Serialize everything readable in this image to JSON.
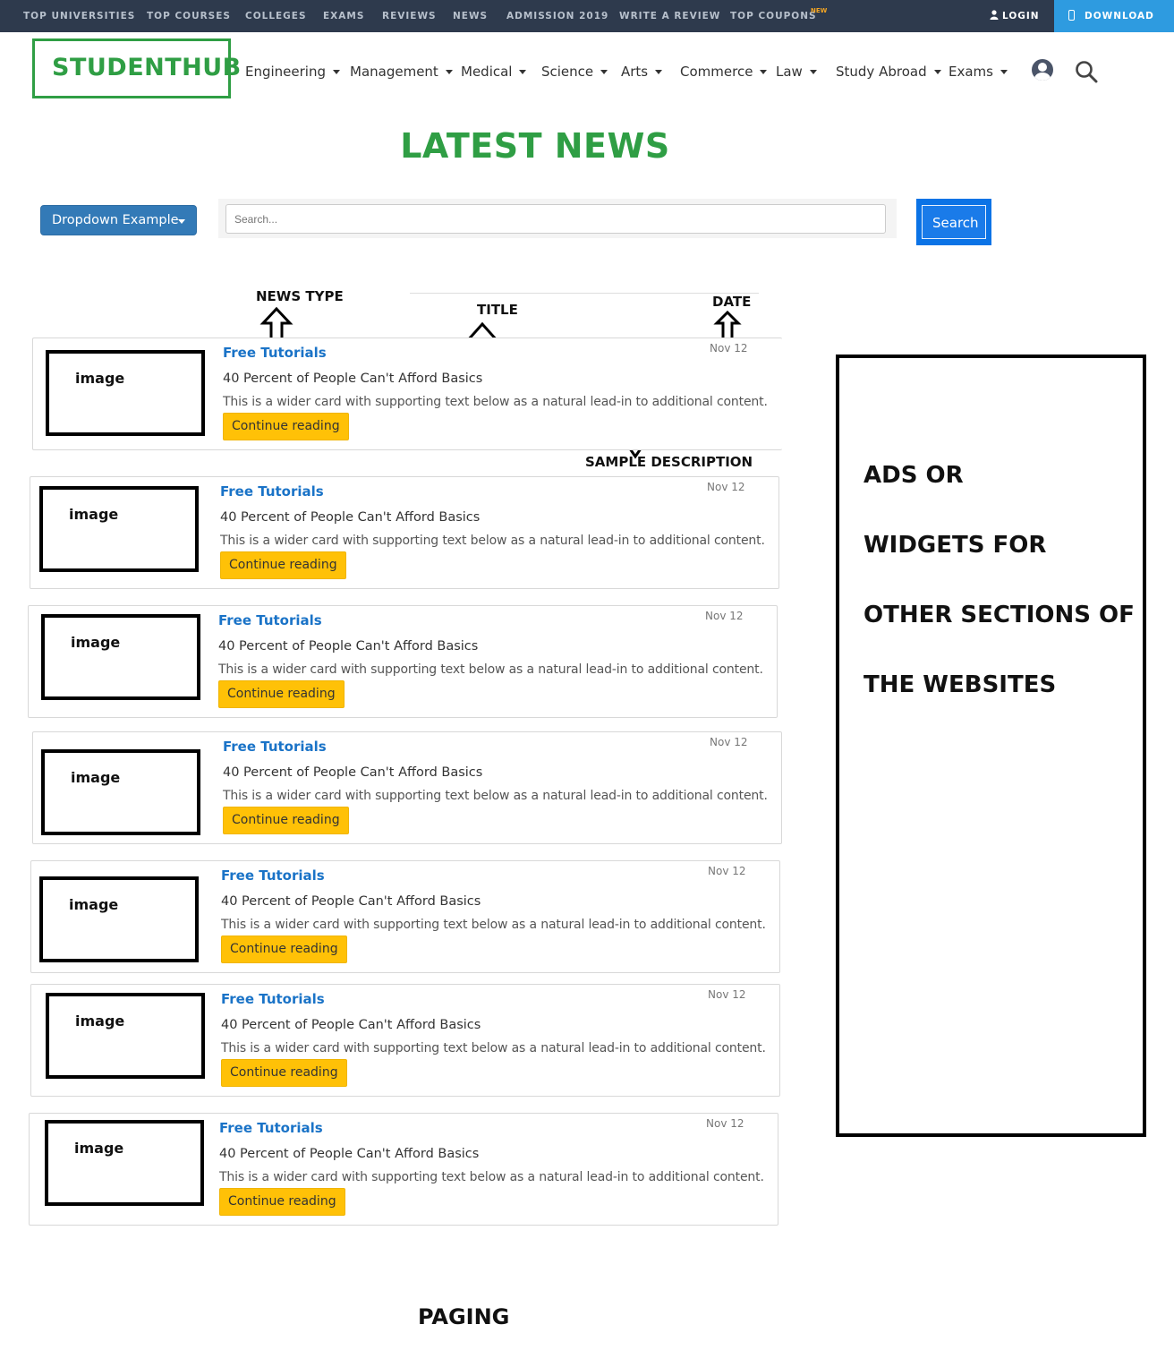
{
  "topbar": {
    "items": [
      "TOP UNIVERSITIES",
      "TOP COURSES",
      "COLLEGES",
      "EXAMS",
      "REVIEWS",
      "NEWS",
      "ADMISSION 2019",
      "WRITE A REVIEW",
      "TOP COUPONS"
    ],
    "new_badge": "NEW",
    "login": "LOGIN",
    "download": "DOWNLOAD"
  },
  "header": {
    "logo": "STUDENTHUB",
    "nav": [
      "Engineering",
      "Management",
      "Medical",
      "Science",
      "Arts",
      "Commerce",
      "Law",
      "Study Abroad",
      "Exams"
    ]
  },
  "page_title": "LATEST NEWS",
  "controls": {
    "dropdown_label": "Dropdown Example",
    "search_placeholder": "Search...",
    "search_button": "Search"
  },
  "annotations": {
    "news_type": "NEWS TYPE",
    "title": "TITLE",
    "date": "DATE",
    "sample_description": "SAMPLE DESCRIPTION"
  },
  "cards": [
    {
      "image": "image",
      "type": "Free Tutorials",
      "title": "40 Percent of People Can't Afford Basics",
      "description": "This is a wider card with supporting text below as a natural lead-in to additional content.",
      "date": "Nov 12",
      "button": "Continue reading"
    },
    {
      "image": "image",
      "type": "Free Tutorials",
      "title": "40 Percent of People Can't Afford Basics",
      "description": "This is a wider card with supporting text below as a natural lead-in to additional content.",
      "date": "Nov 12",
      "button": "Continue reading"
    },
    {
      "image": "image",
      "type": "Free Tutorials",
      "title": "40 Percent of People Can't Afford Basics",
      "description": "This is a wider card with supporting text below as a natural lead-in to additional content.",
      "date": "Nov 12",
      "button": "Continue reading"
    },
    {
      "image": "image",
      "type": "Free Tutorials",
      "title": "40 Percent of People Can't Afford Basics",
      "description": "This is a wider card with supporting text below as a natural lead-in to additional content.",
      "date": "Nov 12",
      "button": "Continue reading"
    },
    {
      "image": "image",
      "type": "Free Tutorials",
      "title": "40 Percent of People Can't Afford Basics",
      "description": "This is a wider card with supporting text below as a natural lead-in to additional content.",
      "date": "Nov 12",
      "button": "Continue reading"
    },
    {
      "image": "image",
      "type": "Free Tutorials",
      "title": "40 Percent of People Can't Afford Basics",
      "description": "This is a wider card with supporting text below as a natural lead-in to additional content.",
      "date": "Nov 12",
      "button": "Continue reading"
    },
    {
      "image": "image",
      "type": "Free Tutorials",
      "title": "40 Percent of People Can't Afford Basics",
      "description": "This is a wider card with supporting text below as a natural lead-in to additional content.",
      "date": "Nov 12",
      "button": "Continue reading"
    }
  ],
  "side_panel": {
    "lines": [
      "ADS OR",
      "WIDGETS FOR",
      "OTHER SECTIONS OF",
      "THE WEBSITES"
    ]
  },
  "paging": "PAGING",
  "colors": {
    "topbar": "#2e3a4d",
    "brand_green": "#2f9e44",
    "link_blue": "#1a73c7",
    "button_yellow": "#ffc107",
    "dropdown_blue": "#337ab7",
    "search_blue": "#1a7be9",
    "download_blue": "#2e9be0"
  }
}
